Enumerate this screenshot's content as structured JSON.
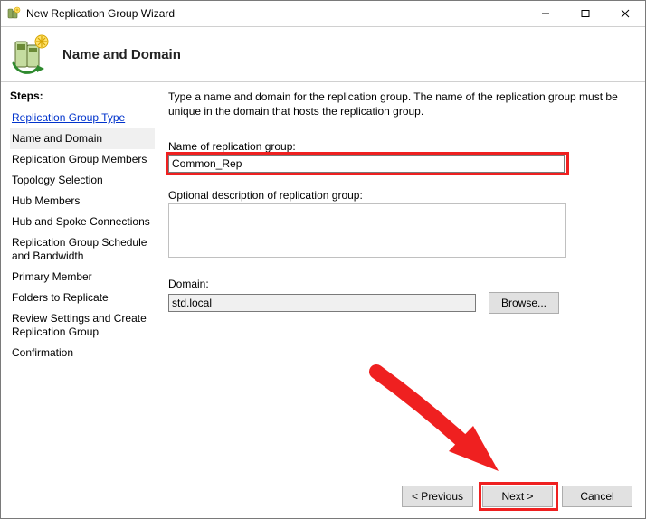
{
  "window_title": "New Replication Group Wizard",
  "header_title": "Name and Domain",
  "sidebar_heading": "Steps:",
  "steps": [
    "Replication Group Type",
    "Name and Domain",
    "Replication Group Members",
    "Topology Selection",
    "Hub Members",
    "Hub and Spoke Connections",
    "Replication Group Schedule and Bandwidth",
    "Primary Member",
    "Folders to Replicate",
    "Review Settings and Create Replication Group",
    "Confirmation"
  ],
  "intro": "Type a name and domain for the replication group. The name of the replication group must be unique in the domain that hosts the replication group.",
  "labels": {
    "name": "Name of replication group:",
    "description": "Optional description of replication group:",
    "domain": "Domain:"
  },
  "values": {
    "name": "Common_Rep",
    "description": "",
    "domain": "std.local"
  },
  "buttons": {
    "browse": "Browse...",
    "previous": "< Previous",
    "next": "Next >",
    "cancel": "Cancel"
  },
  "colors": {
    "highlight": "#ef2020"
  }
}
